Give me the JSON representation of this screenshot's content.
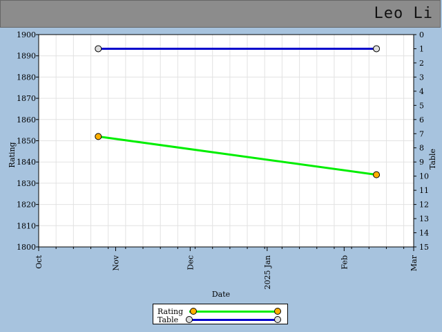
{
  "header": {
    "name": "Leo Li"
  },
  "chart_data": {
    "type": "line",
    "xlabel": "Date",
    "ylabel": "Rating",
    "y2label": "Table",
    "x_ticks": [
      "Oct",
      "Nov",
      "Dec",
      "2025 Jan",
      "Feb",
      "Mar"
    ],
    "x_range": [
      "2024-10-01",
      "2025-03-01"
    ],
    "ylim": [
      1800,
      1900
    ],
    "y_ticks": [
      1800,
      1810,
      1820,
      1830,
      1840,
      1850,
      1860,
      1870,
      1880,
      1890,
      1900
    ],
    "y2lim": [
      0,
      15
    ],
    "y2_ticks": [
      0,
      1,
      2,
      3,
      4,
      5,
      6,
      7,
      8,
      9,
      10,
      11,
      12,
      13,
      14,
      15
    ],
    "y2_inverted": true,
    "grid": true,
    "legend_position": "bottom-center",
    "series": [
      {
        "name": "Rating",
        "axis": "left",
        "color": "#00ee00",
        "marker_color": "#ffb000",
        "x": [
          "2024-10-25",
          "2025-02-14"
        ],
        "values": [
          1852,
          1834
        ]
      },
      {
        "name": "Table",
        "axis": "right",
        "color": "#0000cc",
        "marker_color": "#dddddd",
        "x": [
          "2024-10-25",
          "2025-02-14"
        ],
        "values": [
          1,
          1
        ]
      }
    ]
  }
}
